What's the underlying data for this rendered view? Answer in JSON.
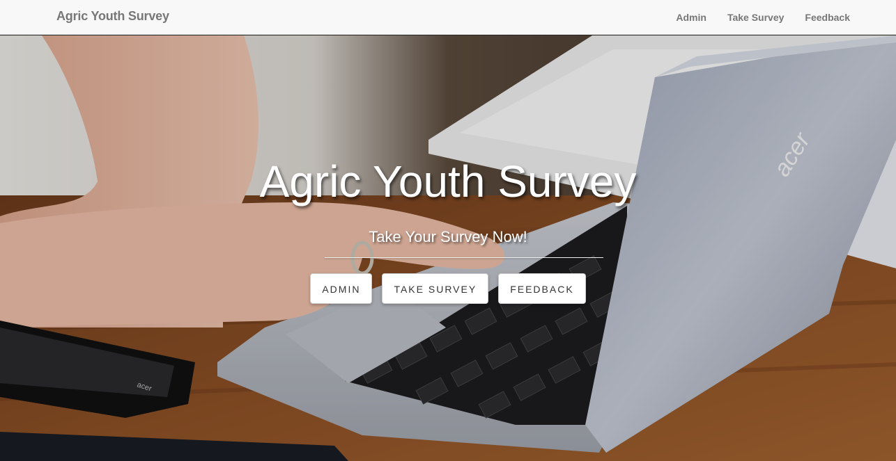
{
  "navbar": {
    "brand": "Agric Youth Survey",
    "links": [
      {
        "label": "Admin"
      },
      {
        "label": "Take Survey"
      },
      {
        "label": "Feedback"
      }
    ]
  },
  "hero": {
    "title": "Agric Youth Survey",
    "subtitle": "Take Your Survey Now!",
    "buttons": [
      {
        "label": "ADMIN"
      },
      {
        "label": "TAKE SURVEY"
      },
      {
        "label": "FEEDBACK"
      }
    ],
    "laptop_logo": "acer",
    "phone_logo": "acer"
  },
  "colors": {
    "navbar_bg": "#f8f8f8",
    "nav_text": "#777777",
    "hero_text": "#ffffff",
    "desk_wood": "#8a4f25"
  }
}
